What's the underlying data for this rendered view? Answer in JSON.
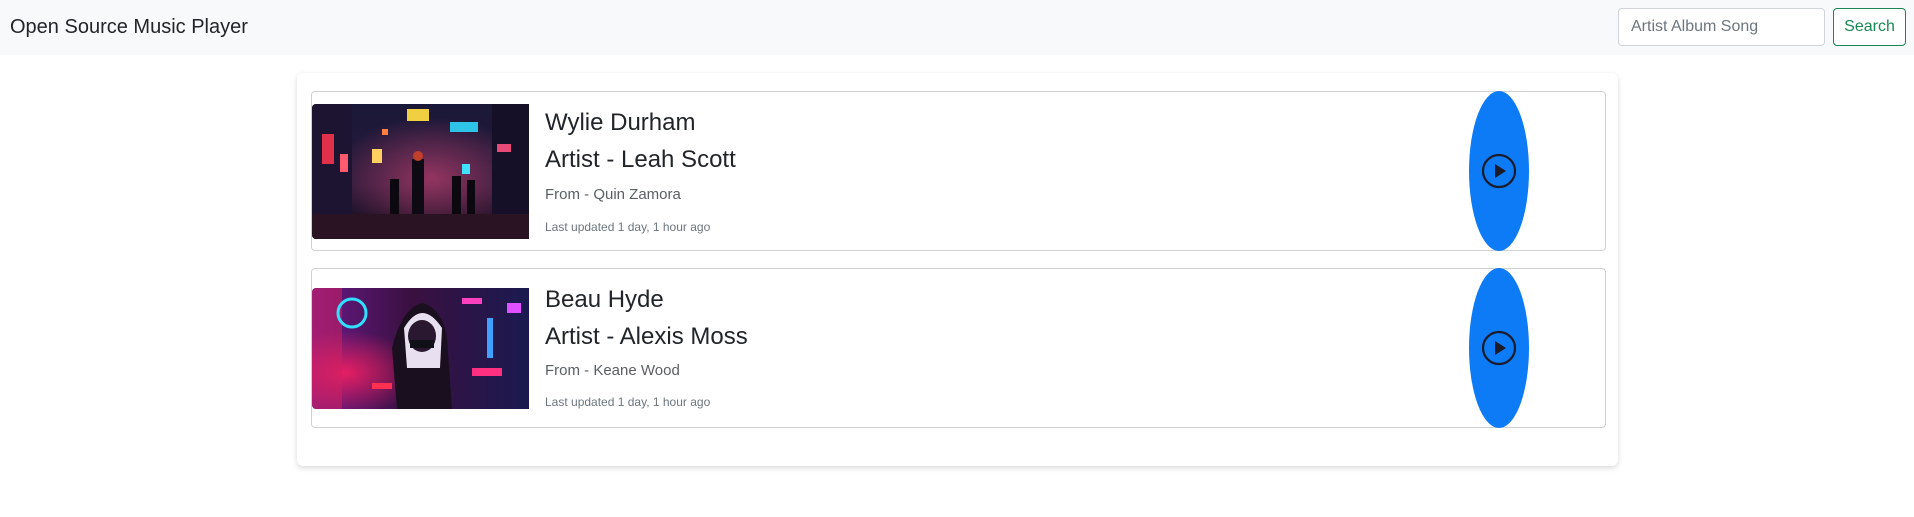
{
  "app": {
    "title": "Open Source Music Player"
  },
  "search": {
    "placeholder": "Artist Album Song",
    "button_label": "Search"
  },
  "songs": [
    {
      "title": "Wylie Durham",
      "artist": "Artist - Leah Scott",
      "from": "From - Quin Zamora",
      "updated": "Last updated 1 day, 1 hour ago",
      "cover_icon": "cyberpunk-street-image"
    },
    {
      "title": "Beau Hyde",
      "artist": "Artist - Alexis Moss",
      "from": "From - Keane Wood",
      "updated": "Last updated 1 day, 1 hour ago",
      "cover_icon": "neon-girl-image"
    }
  ],
  "colors": {
    "navbar_bg": "#f8f9fa",
    "search_button": "#198754",
    "play_button": "#0d7bf5"
  },
  "icons": {
    "play": "play-circle-icon"
  }
}
